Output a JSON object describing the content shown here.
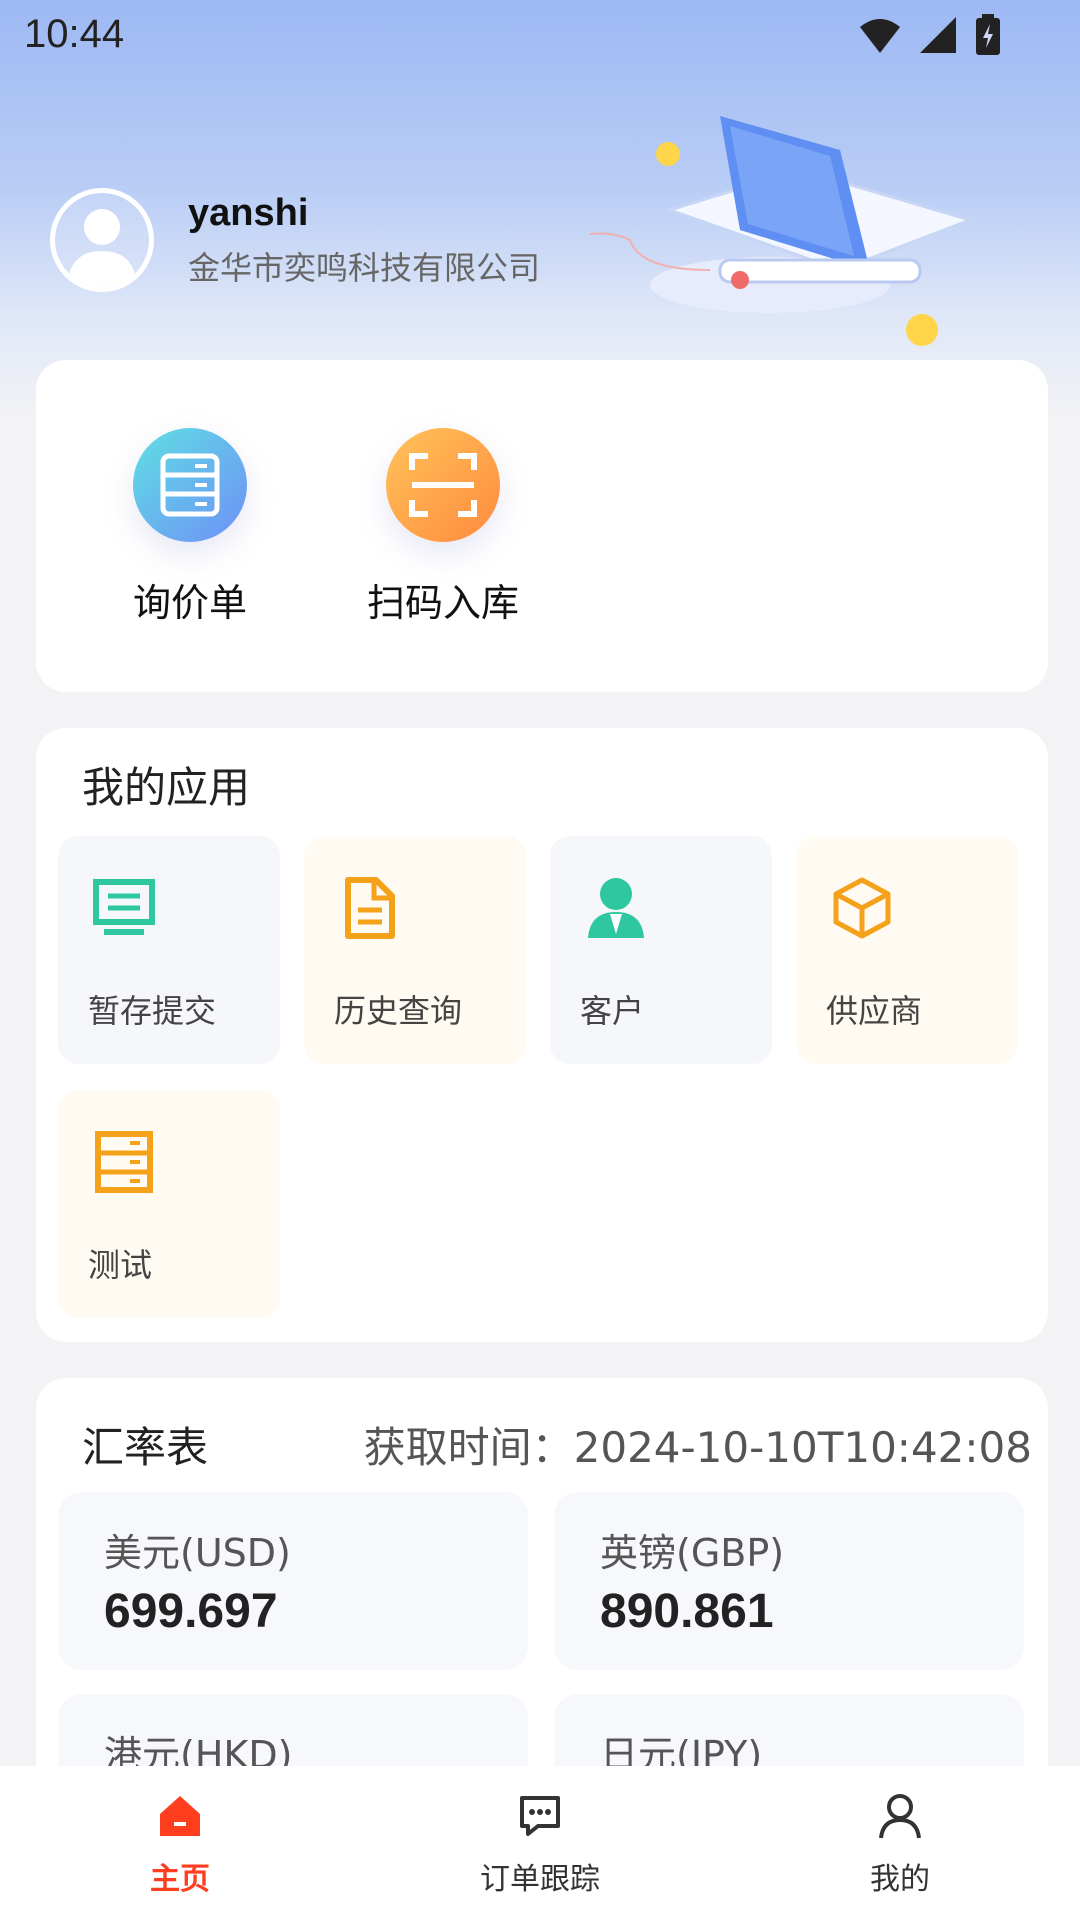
{
  "status_bar": {
    "time": "10:44"
  },
  "profile": {
    "username": "yanshi",
    "company": "金华市奕鸣科技有限公司"
  },
  "quick_actions": [
    {
      "label": "询价单",
      "icon": "server-list-icon"
    },
    {
      "label": "扫码入库",
      "icon": "scan-icon"
    }
  ],
  "apps": {
    "title": "我的应用",
    "items": [
      {
        "label": "暂存提交",
        "icon": "monitor-icon",
        "color": "#2ec7a0"
      },
      {
        "label": "历史查询",
        "icon": "document-icon",
        "color": "#f5a21b"
      },
      {
        "label": "客户",
        "icon": "customer-icon",
        "color": "#2ec7a0"
      },
      {
        "label": "供应商",
        "icon": "cube-icon",
        "color": "#f5a21b"
      },
      {
        "label": "测试",
        "icon": "cabinet-icon",
        "color": "#f5a21b"
      }
    ]
  },
  "rates": {
    "title": "汇率表",
    "fetch_time": "获取时间：2024-10-10T10:42:08",
    "items": [
      {
        "name": "美元(USD)",
        "value": "699.697"
      },
      {
        "name": "英镑(GBP)",
        "value": "890.861"
      },
      {
        "name": "港元(HKD)",
        "value": ""
      },
      {
        "name": "日元(JPY)",
        "value": ""
      }
    ]
  },
  "bottom_nav": [
    {
      "label": "主页",
      "icon": "home-icon",
      "active": true
    },
    {
      "label": "订单跟踪",
      "icon": "chat-icon",
      "active": false
    },
    {
      "label": "我的",
      "icon": "person-icon",
      "active": false
    }
  ],
  "colors": {
    "accent": "#ff3d1f",
    "green": "#2ec7a0",
    "orange": "#f5a21b"
  }
}
